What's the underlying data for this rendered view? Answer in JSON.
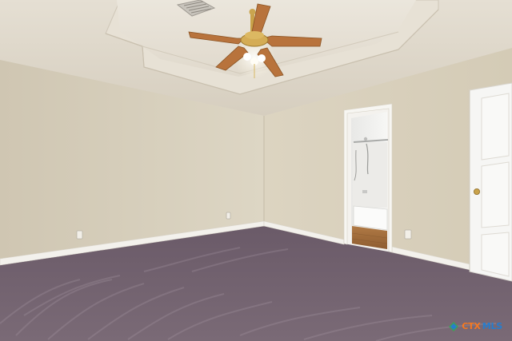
{
  "watermark": {
    "prefix": "CTX",
    "suffix": "MLS"
  },
  "colors": {
    "wall": "#d9d1bf",
    "ceiling": "#ddd6c8",
    "carpet": "#6f5f6c",
    "trim": "#f3f1ec",
    "door": "#f6f6f4",
    "fan_blade": "#b8733c",
    "fan_brass": "#c9a24a"
  }
}
